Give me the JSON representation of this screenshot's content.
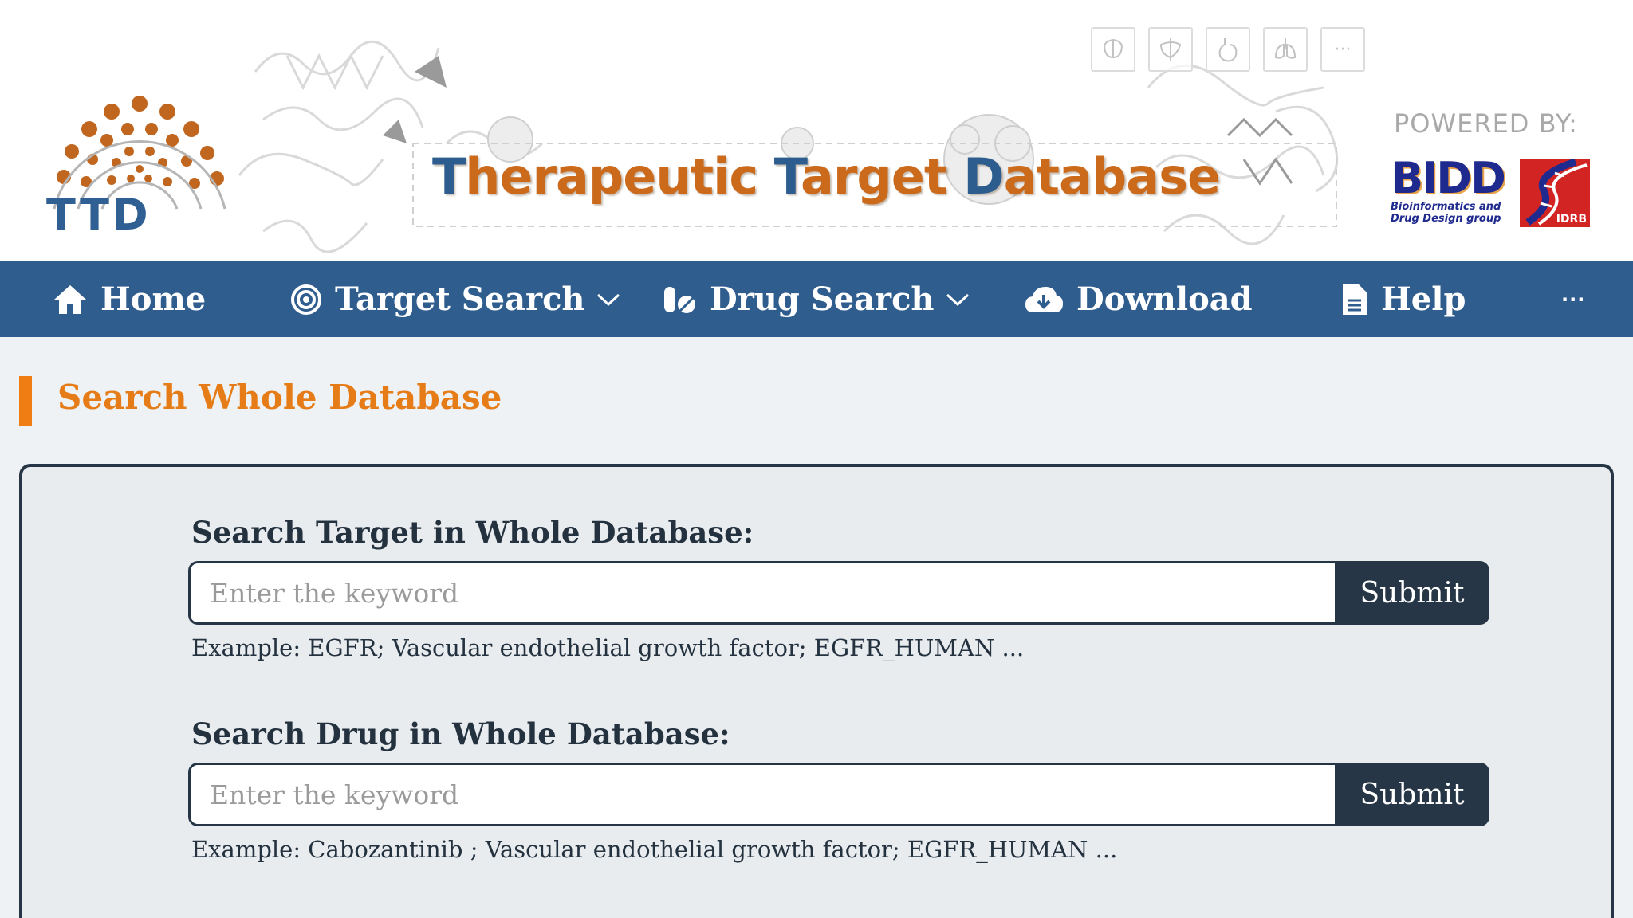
{
  "header": {
    "logo_text": "TTD",
    "title_parts": [
      {
        "text": "T",
        "color": "#2d5d8e"
      },
      {
        "text": "herapeutic ",
        "color": "#cc6a1c"
      },
      {
        "text": "T",
        "color": "#2d5d8e"
      },
      {
        "text": "arget ",
        "color": "#cc6a1c"
      },
      {
        "text": "D",
        "color": "#2d5d8e"
      },
      {
        "text": "atabase",
        "color": "#cc6a1c"
      }
    ],
    "organ_icons": [
      "brain-icon",
      "liver-icon",
      "stomach-icon",
      "lungs-icon",
      "more-icon"
    ],
    "organ_more_label": "···",
    "powered_by": "POWERED BY:",
    "bidd_name": "BIDD",
    "bidd_subtitle_1": "Bioinformatics and",
    "bidd_subtitle_2": "Drug Design group",
    "idrb_name": "IDRB"
  },
  "nav": {
    "items": [
      {
        "label": "Home",
        "icon": "home-icon"
      },
      {
        "label": "Target Search",
        "icon": "target-icon",
        "dropdown": true
      },
      {
        "label": "Drug Search",
        "icon": "pills-icon",
        "dropdown": true
      },
      {
        "label": "Download",
        "icon": "cloud-download-icon"
      },
      {
        "label": "Help",
        "icon": "document-icon"
      }
    ],
    "more_label": "···"
  },
  "section": {
    "title": "Search Whole Database"
  },
  "search": {
    "target": {
      "label": "Search Target in Whole Database:",
      "placeholder": "Enter the keyword",
      "value": "",
      "button": "Submit",
      "example": "Example: EGFR; Vascular endothelial growth factor; EGFR_HUMAN ..."
    },
    "drug": {
      "label": "Search Drug in Whole Database:",
      "placeholder": "Enter the keyword",
      "value": "",
      "button": "Submit",
      "example": "Example: Cabozantinib ; Vascular endothelial growth factor; EGFR_HUMAN ..."
    }
  },
  "colors": {
    "nav_bg": "#2f5d8e",
    "accent_orange": "#ef7d14",
    "dark_button": "#263646",
    "page_bg": "#eef2f4"
  }
}
